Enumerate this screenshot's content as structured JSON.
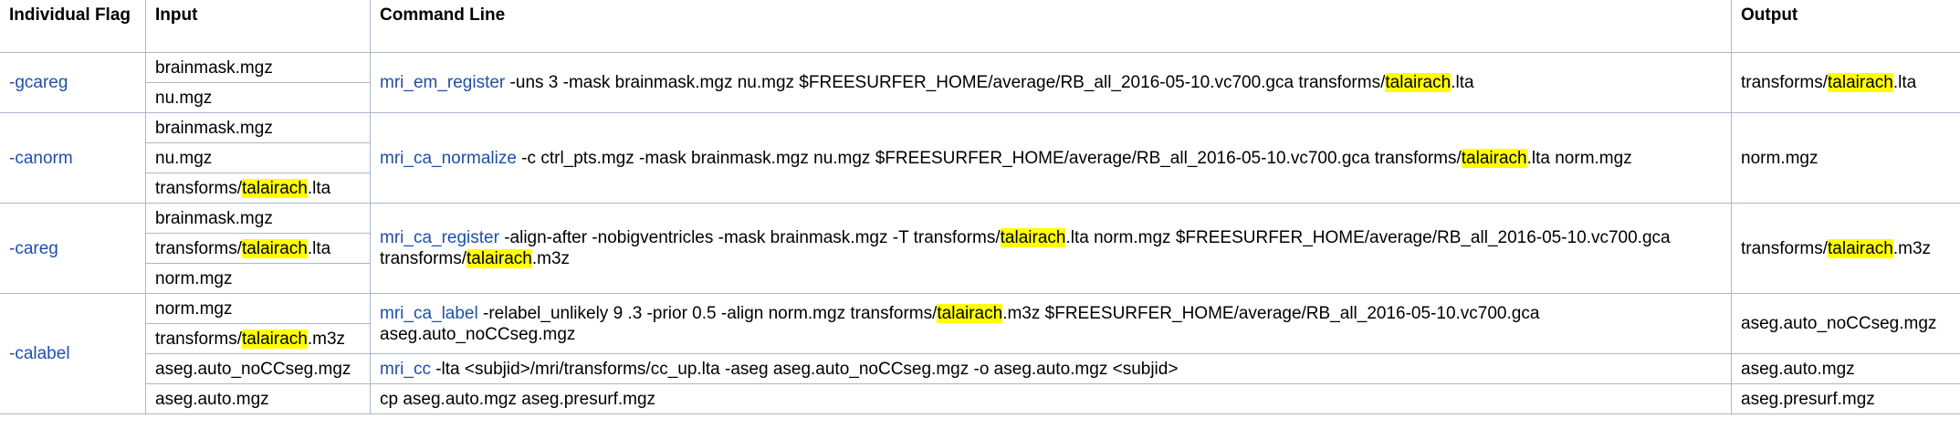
{
  "header": {
    "flag": "Individual Flag",
    "input": "Input",
    "command": "Command Line",
    "output": "Output"
  },
  "highlight_term": "talairach",
  "groups": [
    {
      "flag": "-gcareg",
      "inputs": [
        "brainmask.mgz",
        "nu.mgz"
      ],
      "commands": [
        {
          "tool": "mri_em_register",
          "args": " -uns 3 -mask brainmask.mgz nu.mgz $FREESURFER_HOME/average/RB_all_2016-05-10.vc700.gca transforms/talairach.lta",
          "rowspan": 2,
          "output": "transforms/talairach.lta"
        }
      ]
    },
    {
      "flag": "-canorm",
      "inputs": [
        "brainmask.mgz",
        "nu.mgz",
        "transforms/talairach.lta"
      ],
      "commands": [
        {
          "tool": "mri_ca_normalize",
          "args": " -c ctrl_pts.mgz -mask brainmask.mgz nu.mgz $FREESURFER_HOME/average/RB_all_2016-05-10.vc700.gca transforms/talairach.lta norm.mgz",
          "rowspan": 3,
          "output": "norm.mgz"
        }
      ]
    },
    {
      "flag": "-careg",
      "inputs": [
        "brainmask.mgz",
        "transforms/talairach.lta",
        "norm.mgz"
      ],
      "commands": [
        {
          "tool": "mri_ca_register",
          "args": " -align-after -nobigventricles -mask brainmask.mgz -T transforms/talairach.lta norm.mgz $FREESURFER_HOME/average/RB_all_2016-05-10.vc700.gca transforms/talairach.m3z",
          "rowspan": 3,
          "output": "transforms/talairach.m3z"
        }
      ]
    },
    {
      "flag": "-calabel",
      "inputs": [
        "norm.mgz",
        "transforms/talairach.m3z",
        "aseg.auto_noCCseg.mgz",
        "aseg.auto.mgz"
      ],
      "commands": [
        {
          "tool": "mri_ca_label",
          "args": " -relabel_unlikely 9 .3 -prior 0.5 -align norm.mgz transforms/talairach.m3z $FREESURFER_HOME/average/RB_all_2016-05-10.vc700.gca aseg.auto_noCCseg.mgz",
          "rowspan": 2,
          "output": "aseg.auto_noCCseg.mgz"
        },
        {
          "tool": "mri_cc",
          "args": " -lta <subjid>/mri/transforms/cc_up.lta -aseg aseg.auto_noCCseg.mgz -o aseg.auto.mgz <subjid>",
          "rowspan": 1,
          "output": "aseg.auto.mgz"
        },
        {
          "tool": "",
          "args": "cp aseg.auto.mgz aseg.presurf.mgz",
          "rowspan": 1,
          "output": "aseg.presurf.mgz"
        }
      ]
    }
  ]
}
